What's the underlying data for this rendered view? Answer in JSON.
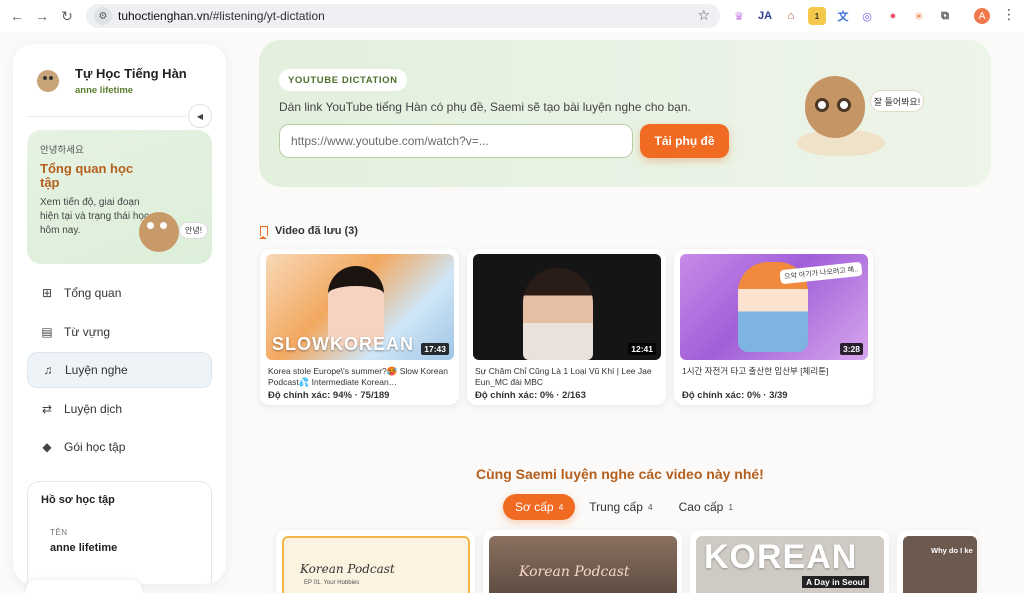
{
  "browser": {
    "url_host": "tuhoctienghan.vn",
    "url_path": "/#listening/yt-dictation",
    "profile_initial": "A",
    "extension_badge": "1"
  },
  "sidebar": {
    "brand_title": "Tự Học Tiếng Hàn",
    "brand_subtitle": "anne lifetime",
    "hero": {
      "hello": "안녕하세요",
      "title": "Tổng quan học tập",
      "description": "Xem tiến độ, giai đoạn hiện tại và trạng thái học hôm nay.",
      "bubble": "안녕!"
    },
    "menu": [
      {
        "label": "Tổng quan",
        "icon": "grid-icon"
      },
      {
        "label": "Từ vựng",
        "icon": "book-icon"
      },
      {
        "label": "Luyện nghe",
        "icon": "headphones-icon",
        "active": true
      },
      {
        "label": "Luyện dịch",
        "icon": "swap-icon"
      },
      {
        "label": "Gói học tập",
        "icon": "diamond-icon"
      }
    ],
    "profile": {
      "title": "Hồ sơ học tập",
      "name_label": "TÊN",
      "name_value": "anne lifetime"
    }
  },
  "banner": {
    "tag": "YOUTUBE DICTATION",
    "description": "Dán link YouTube tiếng Hàn có phụ đề, Saemi sẽ tạo bài luyện nghe cho bạn.",
    "input_placeholder": "https://www.youtube.com/watch?v=...",
    "button_label": "Tải phụ đề",
    "mascot_bubble": "잘 들어봐요!"
  },
  "saved": {
    "heading": "Video đã lưu (3)",
    "videos": [
      {
        "title": "Korea stole Europe\\'s summer?🥵 Slow Korean Podcast💦 Intermediate Korean…",
        "duration": "17:43",
        "accuracy": "Độ chính xác: 94% · 75/189",
        "thumb_text": "SLOWKOREAN"
      },
      {
        "title": "Sự Chăm Chỉ Cũng Là 1 Loại Vũ Khí | Lee Jae Eun_MC đài MBC",
        "duration": "12:41",
        "accuracy": "Độ chính xác: 0% · 2/163"
      },
      {
        "title": "1시간 자전거 타고 출산한 임산부 [체리툰]",
        "duration": "3:28",
        "accuracy": "Độ chính xác: 0% · 3/39",
        "thumb_text": "으악 아기가 나오려고 해.."
      }
    ]
  },
  "recommend": {
    "heading": "Cùng Saemi luyện nghe các video này nhé!",
    "levels": [
      {
        "label": "Sơ cấp",
        "count": "4",
        "active": true
      },
      {
        "label": "Trung cấp",
        "count": "4"
      },
      {
        "label": "Cao cấp",
        "count": "1"
      }
    ],
    "thumbs": [
      {
        "text": "Korean Podcast",
        "sub": "EP 01. Your Hobbies"
      },
      {
        "text": "Korean Podcast"
      },
      {
        "text": "KOREAN",
        "sub": "A Day in Seoul"
      },
      {
        "text": "Why do I ke"
      }
    ]
  }
}
